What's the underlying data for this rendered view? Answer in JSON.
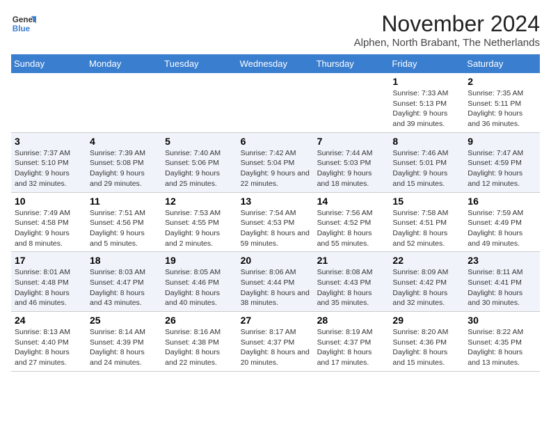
{
  "logo": {
    "general": "General",
    "blue": "Blue"
  },
  "title": "November 2024",
  "subtitle": "Alphen, North Brabant, The Netherlands",
  "headers": [
    "Sunday",
    "Monday",
    "Tuesday",
    "Wednesday",
    "Thursday",
    "Friday",
    "Saturday"
  ],
  "weeks": [
    [
      {
        "day": "",
        "info": ""
      },
      {
        "day": "",
        "info": ""
      },
      {
        "day": "",
        "info": ""
      },
      {
        "day": "",
        "info": ""
      },
      {
        "day": "",
        "info": ""
      },
      {
        "day": "1",
        "info": "Sunrise: 7:33 AM\nSunset: 5:13 PM\nDaylight: 9 hours and 39 minutes."
      },
      {
        "day": "2",
        "info": "Sunrise: 7:35 AM\nSunset: 5:11 PM\nDaylight: 9 hours and 36 minutes."
      }
    ],
    [
      {
        "day": "3",
        "info": "Sunrise: 7:37 AM\nSunset: 5:10 PM\nDaylight: 9 hours and 32 minutes."
      },
      {
        "day": "4",
        "info": "Sunrise: 7:39 AM\nSunset: 5:08 PM\nDaylight: 9 hours and 29 minutes."
      },
      {
        "day": "5",
        "info": "Sunrise: 7:40 AM\nSunset: 5:06 PM\nDaylight: 9 hours and 25 minutes."
      },
      {
        "day": "6",
        "info": "Sunrise: 7:42 AM\nSunset: 5:04 PM\nDaylight: 9 hours and 22 minutes."
      },
      {
        "day": "7",
        "info": "Sunrise: 7:44 AM\nSunset: 5:03 PM\nDaylight: 9 hours and 18 minutes."
      },
      {
        "day": "8",
        "info": "Sunrise: 7:46 AM\nSunset: 5:01 PM\nDaylight: 9 hours and 15 minutes."
      },
      {
        "day": "9",
        "info": "Sunrise: 7:47 AM\nSunset: 4:59 PM\nDaylight: 9 hours and 12 minutes."
      }
    ],
    [
      {
        "day": "10",
        "info": "Sunrise: 7:49 AM\nSunset: 4:58 PM\nDaylight: 9 hours and 8 minutes."
      },
      {
        "day": "11",
        "info": "Sunrise: 7:51 AM\nSunset: 4:56 PM\nDaylight: 9 hours and 5 minutes."
      },
      {
        "day": "12",
        "info": "Sunrise: 7:53 AM\nSunset: 4:55 PM\nDaylight: 9 hours and 2 minutes."
      },
      {
        "day": "13",
        "info": "Sunrise: 7:54 AM\nSunset: 4:53 PM\nDaylight: 8 hours and 59 minutes."
      },
      {
        "day": "14",
        "info": "Sunrise: 7:56 AM\nSunset: 4:52 PM\nDaylight: 8 hours and 55 minutes."
      },
      {
        "day": "15",
        "info": "Sunrise: 7:58 AM\nSunset: 4:51 PM\nDaylight: 8 hours and 52 minutes."
      },
      {
        "day": "16",
        "info": "Sunrise: 7:59 AM\nSunset: 4:49 PM\nDaylight: 8 hours and 49 minutes."
      }
    ],
    [
      {
        "day": "17",
        "info": "Sunrise: 8:01 AM\nSunset: 4:48 PM\nDaylight: 8 hours and 46 minutes."
      },
      {
        "day": "18",
        "info": "Sunrise: 8:03 AM\nSunset: 4:47 PM\nDaylight: 8 hours and 43 minutes."
      },
      {
        "day": "19",
        "info": "Sunrise: 8:05 AM\nSunset: 4:46 PM\nDaylight: 8 hours and 40 minutes."
      },
      {
        "day": "20",
        "info": "Sunrise: 8:06 AM\nSunset: 4:44 PM\nDaylight: 8 hours and 38 minutes."
      },
      {
        "day": "21",
        "info": "Sunrise: 8:08 AM\nSunset: 4:43 PM\nDaylight: 8 hours and 35 minutes."
      },
      {
        "day": "22",
        "info": "Sunrise: 8:09 AM\nSunset: 4:42 PM\nDaylight: 8 hours and 32 minutes."
      },
      {
        "day": "23",
        "info": "Sunrise: 8:11 AM\nSunset: 4:41 PM\nDaylight: 8 hours and 30 minutes."
      }
    ],
    [
      {
        "day": "24",
        "info": "Sunrise: 8:13 AM\nSunset: 4:40 PM\nDaylight: 8 hours and 27 minutes."
      },
      {
        "day": "25",
        "info": "Sunrise: 8:14 AM\nSunset: 4:39 PM\nDaylight: 8 hours and 24 minutes."
      },
      {
        "day": "26",
        "info": "Sunrise: 8:16 AM\nSunset: 4:38 PM\nDaylight: 8 hours and 22 minutes."
      },
      {
        "day": "27",
        "info": "Sunrise: 8:17 AM\nSunset: 4:37 PM\nDaylight: 8 hours and 20 minutes."
      },
      {
        "day": "28",
        "info": "Sunrise: 8:19 AM\nSunset: 4:37 PM\nDaylight: 8 hours and 17 minutes."
      },
      {
        "day": "29",
        "info": "Sunrise: 8:20 AM\nSunset: 4:36 PM\nDaylight: 8 hours and 15 minutes."
      },
      {
        "day": "30",
        "info": "Sunrise: 8:22 AM\nSunset: 4:35 PM\nDaylight: 8 hours and 13 minutes."
      }
    ]
  ]
}
